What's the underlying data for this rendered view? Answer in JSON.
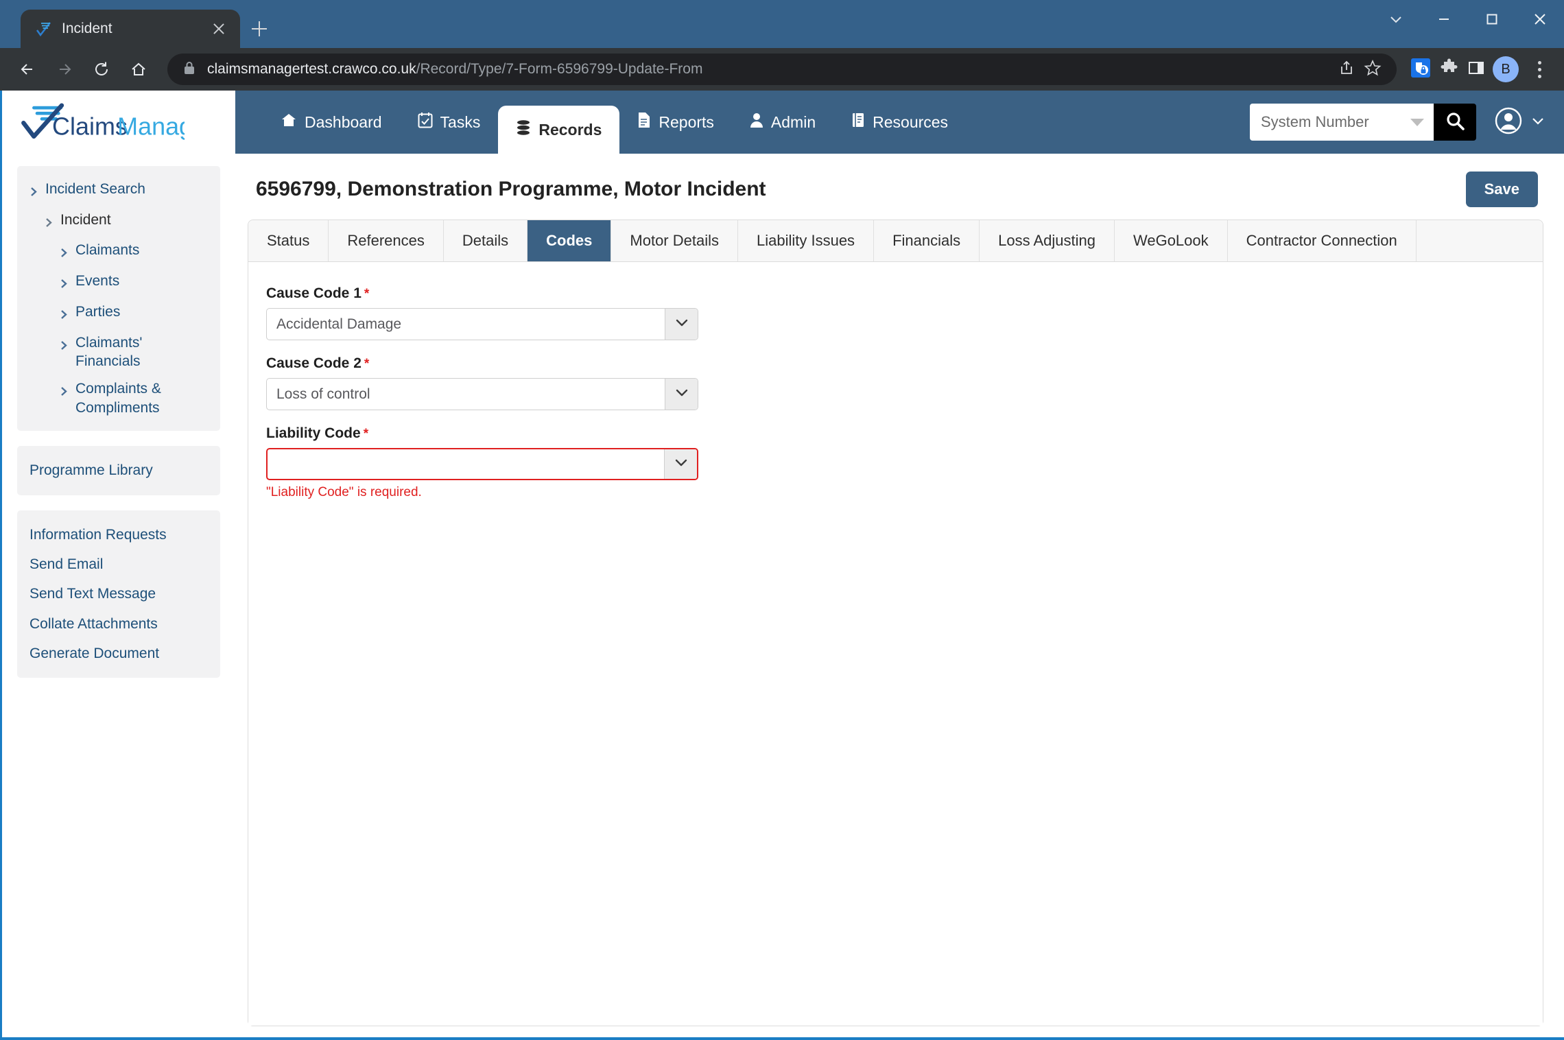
{
  "browser": {
    "tab": {
      "title": "Incident",
      "favicon_icon": "claimsmanager-check-icon",
      "close_icon": "close-icon"
    },
    "new_tab_icon": "plus-icon",
    "window_controls": [
      {
        "name": "tab-search",
        "icon": "chevron-down-icon"
      },
      {
        "name": "minimize",
        "icon": "minimize-icon"
      },
      {
        "name": "maximize",
        "icon": "maximize-icon"
      },
      {
        "name": "close",
        "icon": "close-icon"
      }
    ],
    "nav": {
      "back_icon": "arrow-left-icon",
      "forward_icon": "arrow-right-icon",
      "reload_icon": "reload-icon",
      "home_icon": "home-icon"
    },
    "omnibox": {
      "lock_icon": "lock-icon",
      "url_domain": "claimsmanagertest.crawco.co.uk",
      "url_path": "/Record/Type/7-Form-6596799-Update-From",
      "share_icon": "share-icon",
      "bookmark_icon": "star-icon"
    },
    "extensions": [
      {
        "name": "password-manager-extension",
        "icon": "shield-lock-icon",
        "color": "#1a73e8"
      },
      {
        "name": "extensions-menu",
        "icon": "puzzle-icon"
      },
      {
        "name": "side-panel",
        "icon": "panel-icon"
      }
    ],
    "profile": {
      "initial": "B",
      "color": "#8ab4f8"
    },
    "menu_icon": "kebab-menu-icon"
  },
  "app": {
    "logo": {
      "text": "ClaimsManager",
      "icon": "claimsmanager-logo"
    },
    "nav_items": [
      {
        "label": "Dashboard",
        "icon": "home-icon",
        "active": false
      },
      {
        "label": "Tasks",
        "icon": "calendar-check-icon",
        "active": false
      },
      {
        "label": "Records",
        "icon": "database-icon",
        "active": true
      },
      {
        "label": "Reports",
        "icon": "document-icon",
        "active": false
      },
      {
        "label": "Admin",
        "icon": "user-icon",
        "active": false
      },
      {
        "label": "Resources",
        "icon": "book-icon",
        "active": false
      }
    ],
    "search": {
      "selected": "System Number",
      "caret_icon": "caret-down-icon",
      "search_icon": "search-icon"
    },
    "user": {
      "avatar_icon": "user-circle-icon",
      "caret_icon": "chevron-down-icon"
    }
  },
  "sidebar": {
    "tree": [
      {
        "label": "Incident Search",
        "level": 0,
        "chevron": "chevron-right-icon",
        "current": false
      },
      {
        "label": "Incident",
        "level": 1,
        "chevron": "chevron-right-icon",
        "current": true
      },
      {
        "label": "Claimants",
        "level": 2,
        "chevron": "chevron-right-icon",
        "current": false
      },
      {
        "label": "Events",
        "level": 2,
        "chevron": "chevron-right-icon",
        "current": false
      },
      {
        "label": "Parties",
        "level": 2,
        "chevron": "chevron-right-icon",
        "current": false
      },
      {
        "label": "Claimants' Financials",
        "level": 2,
        "chevron": "chevron-right-icon",
        "current": false
      },
      {
        "label": "Complaints & Compliments",
        "level": 2,
        "chevron": "chevron-right-icon",
        "current": false
      }
    ],
    "library": [
      {
        "label": "Programme Library"
      }
    ],
    "actions": [
      {
        "label": "Information Requests"
      },
      {
        "label": "Send Email"
      },
      {
        "label": "Send Text Message"
      },
      {
        "label": "Collate Attachments"
      },
      {
        "label": "Generate Document"
      }
    ]
  },
  "record": {
    "title": "6596799, Demonstration Programme, Motor Incident",
    "save_label": "Save",
    "tabs": [
      {
        "label": "Status",
        "active": false
      },
      {
        "label": "References",
        "active": false
      },
      {
        "label": "Details",
        "active": false
      },
      {
        "label": "Codes",
        "active": true
      },
      {
        "label": "Motor Details",
        "active": false
      },
      {
        "label": "Liability Issues",
        "active": false
      },
      {
        "label": "Financials",
        "active": false
      },
      {
        "label": "Loss Adjusting",
        "active": false
      },
      {
        "label": "WeGoLook",
        "active": false
      },
      {
        "label": "Contractor Connection",
        "active": false
      }
    ],
    "fields": [
      {
        "label": "Cause Code 1",
        "required": true,
        "value": "Accidental Damage",
        "error": "",
        "has_error": false
      },
      {
        "label": "Cause Code 2",
        "required": true,
        "value": "Loss of control",
        "error": "",
        "has_error": false
      },
      {
        "label": "Liability Code",
        "required": true,
        "value": "",
        "error": "\"Liability Code\" is required.",
        "has_error": true
      }
    ]
  },
  "colors": {
    "brand_blue": "#3b6184",
    "accent_blue": "#1a7dc4",
    "link_blue": "#1d4f79",
    "error_red": "#e02020",
    "chrome_dark": "#323639",
    "titlebar": "#35618a"
  }
}
